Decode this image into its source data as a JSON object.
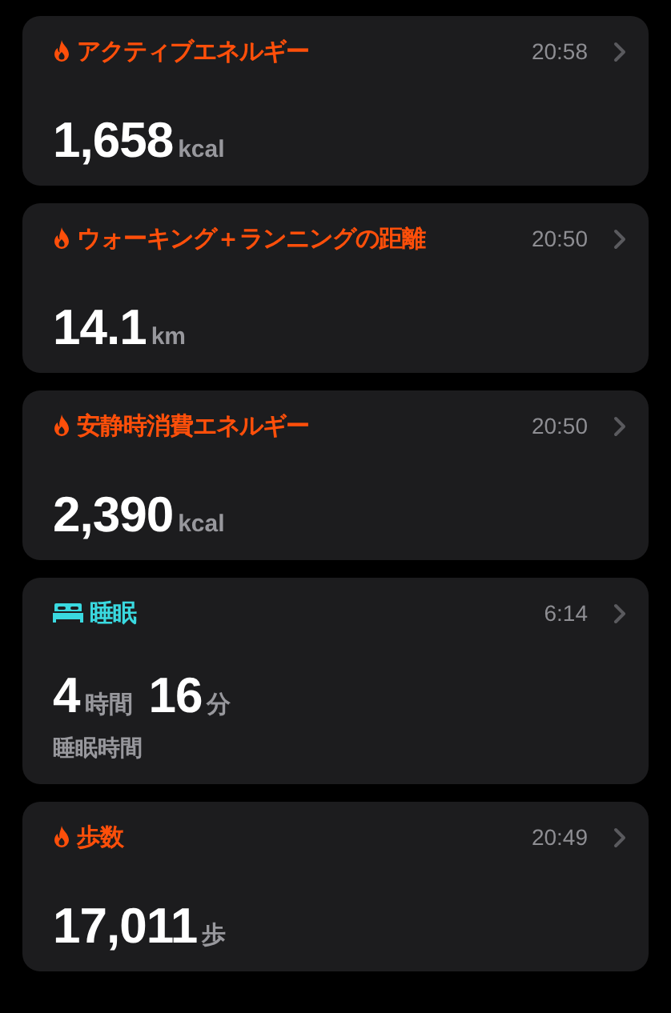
{
  "cards": [
    {
      "kind": "flame",
      "color": "#ff4f0a",
      "title": "アクティブエネルギー",
      "time": "20:58",
      "readings": [
        {
          "number": "1,658",
          "unit": "kcal"
        }
      ]
    },
    {
      "kind": "flame",
      "color": "#ff4f0a",
      "title": "ウォーキング＋ランニングの距離",
      "time": "20:50",
      "readings": [
        {
          "number": "14.1",
          "unit": "km"
        }
      ]
    },
    {
      "kind": "flame",
      "color": "#ff4f0a",
      "title": "安静時消費エネルギー",
      "time": "20:50",
      "readings": [
        {
          "number": "2,390",
          "unit": "kcal"
        }
      ]
    },
    {
      "kind": "bed",
      "color": "#3ad9e0",
      "title": "睡眠",
      "time": "6:14",
      "readings": [
        {
          "number": "4",
          "unit": "時間"
        },
        {
          "number": "16",
          "unit": "分"
        }
      ],
      "caption": "睡眠時間"
    },
    {
      "kind": "flame",
      "color": "#ff4f0a",
      "title": "歩数",
      "time": "20:49",
      "readings": [
        {
          "number": "17,011",
          "unit": "歩"
        }
      ]
    }
  ]
}
